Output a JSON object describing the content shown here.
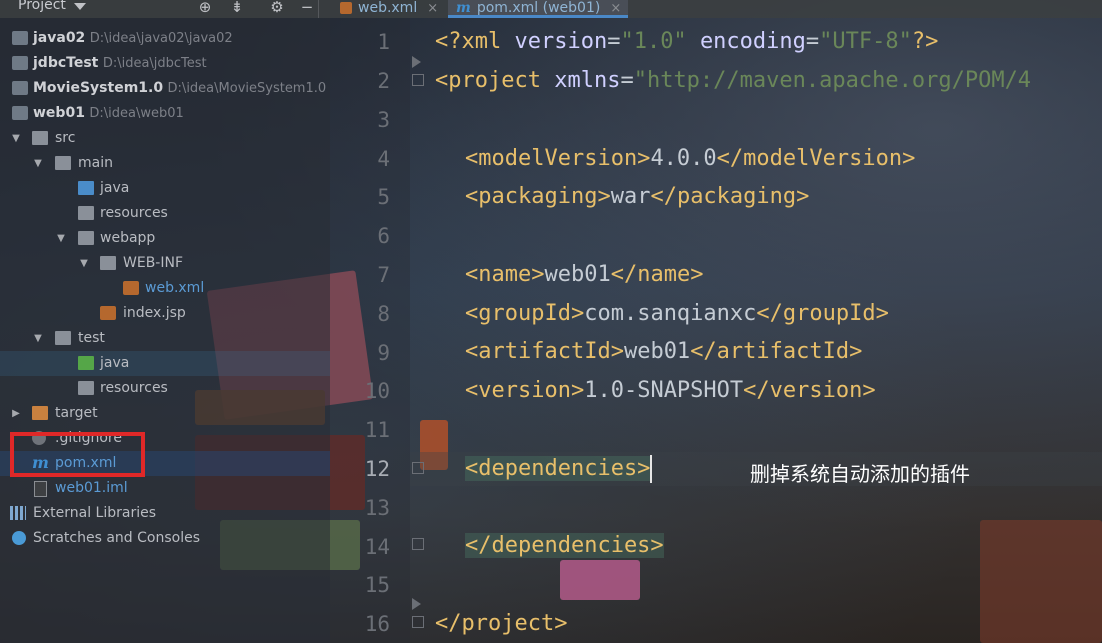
{
  "sidebar": {
    "title": "Project",
    "tree": [
      {
        "label": "java02",
        "path": "D:\\idea\\java02\\java02"
      },
      {
        "label": "jdbcTest",
        "path": "D:\\idea\\jdbcTest"
      },
      {
        "label": "MovieSystem1.0",
        "path": "D:\\idea\\MovieSystem1.0"
      },
      {
        "label": "web01",
        "path": "D:\\idea\\web01"
      },
      {
        "label": "src"
      },
      {
        "label": "main"
      },
      {
        "label": "java"
      },
      {
        "label": "resources"
      },
      {
        "label": "webapp"
      },
      {
        "label": "WEB-INF"
      },
      {
        "label": "web.xml"
      },
      {
        "label": "index.jsp"
      },
      {
        "label": "test"
      },
      {
        "label": "java"
      },
      {
        "label": "resources"
      },
      {
        "label": "target"
      },
      {
        "label": ".gitignore"
      },
      {
        "label": "pom.xml"
      },
      {
        "label": "web01.iml"
      },
      {
        "label": "External Libraries"
      },
      {
        "label": "Scratches and Consoles"
      }
    ]
  },
  "tabs": [
    {
      "label": "web.xml"
    },
    {
      "label": "pom.xml (web01)"
    }
  ],
  "editor": {
    "line_numbers": [
      "1",
      "2",
      "3",
      "4",
      "5",
      "6",
      "7",
      "8",
      "9",
      "10",
      "11",
      "12",
      "13",
      "14",
      "15",
      "16"
    ],
    "lines": {
      "l1": {
        "a": "<?xml ",
        "b": "version",
        "c": "=",
        "d": "\"1.0\"",
        "e": " ",
        "f": "encoding",
        "g": "=",
        "h": "\"UTF-8\"",
        "i": "?>"
      },
      "l2": {
        "a": "<project ",
        "b": "xmlns",
        "c": "=",
        "d": "\"http://maven.apache.org/POM/4"
      },
      "l4": {
        "open": "<modelVersion>",
        "val": "4.0.0",
        "close": "</modelVersion>"
      },
      "l5": {
        "open": "<packaging>",
        "val": "war",
        "close": "</packaging>"
      },
      "l7": {
        "open": "<name>",
        "val": "web01",
        "close": "</name>"
      },
      "l8": {
        "open": "<groupId>",
        "val": "com.sanqianxc",
        "close": "</groupId>"
      },
      "l9": {
        "open": "<artifactId>",
        "val": "web01",
        "close": "</artifactId>"
      },
      "l10": {
        "open": "<version>",
        "val": "1.0-SNAPSHOT",
        "close": "</version>"
      },
      "l12": {
        "open": "<dependencies>"
      },
      "l14": {
        "close": "</dependencies>"
      },
      "l16": {
        "close": "</project>"
      }
    }
  },
  "annotation": "删掉系统自动添加的插件"
}
